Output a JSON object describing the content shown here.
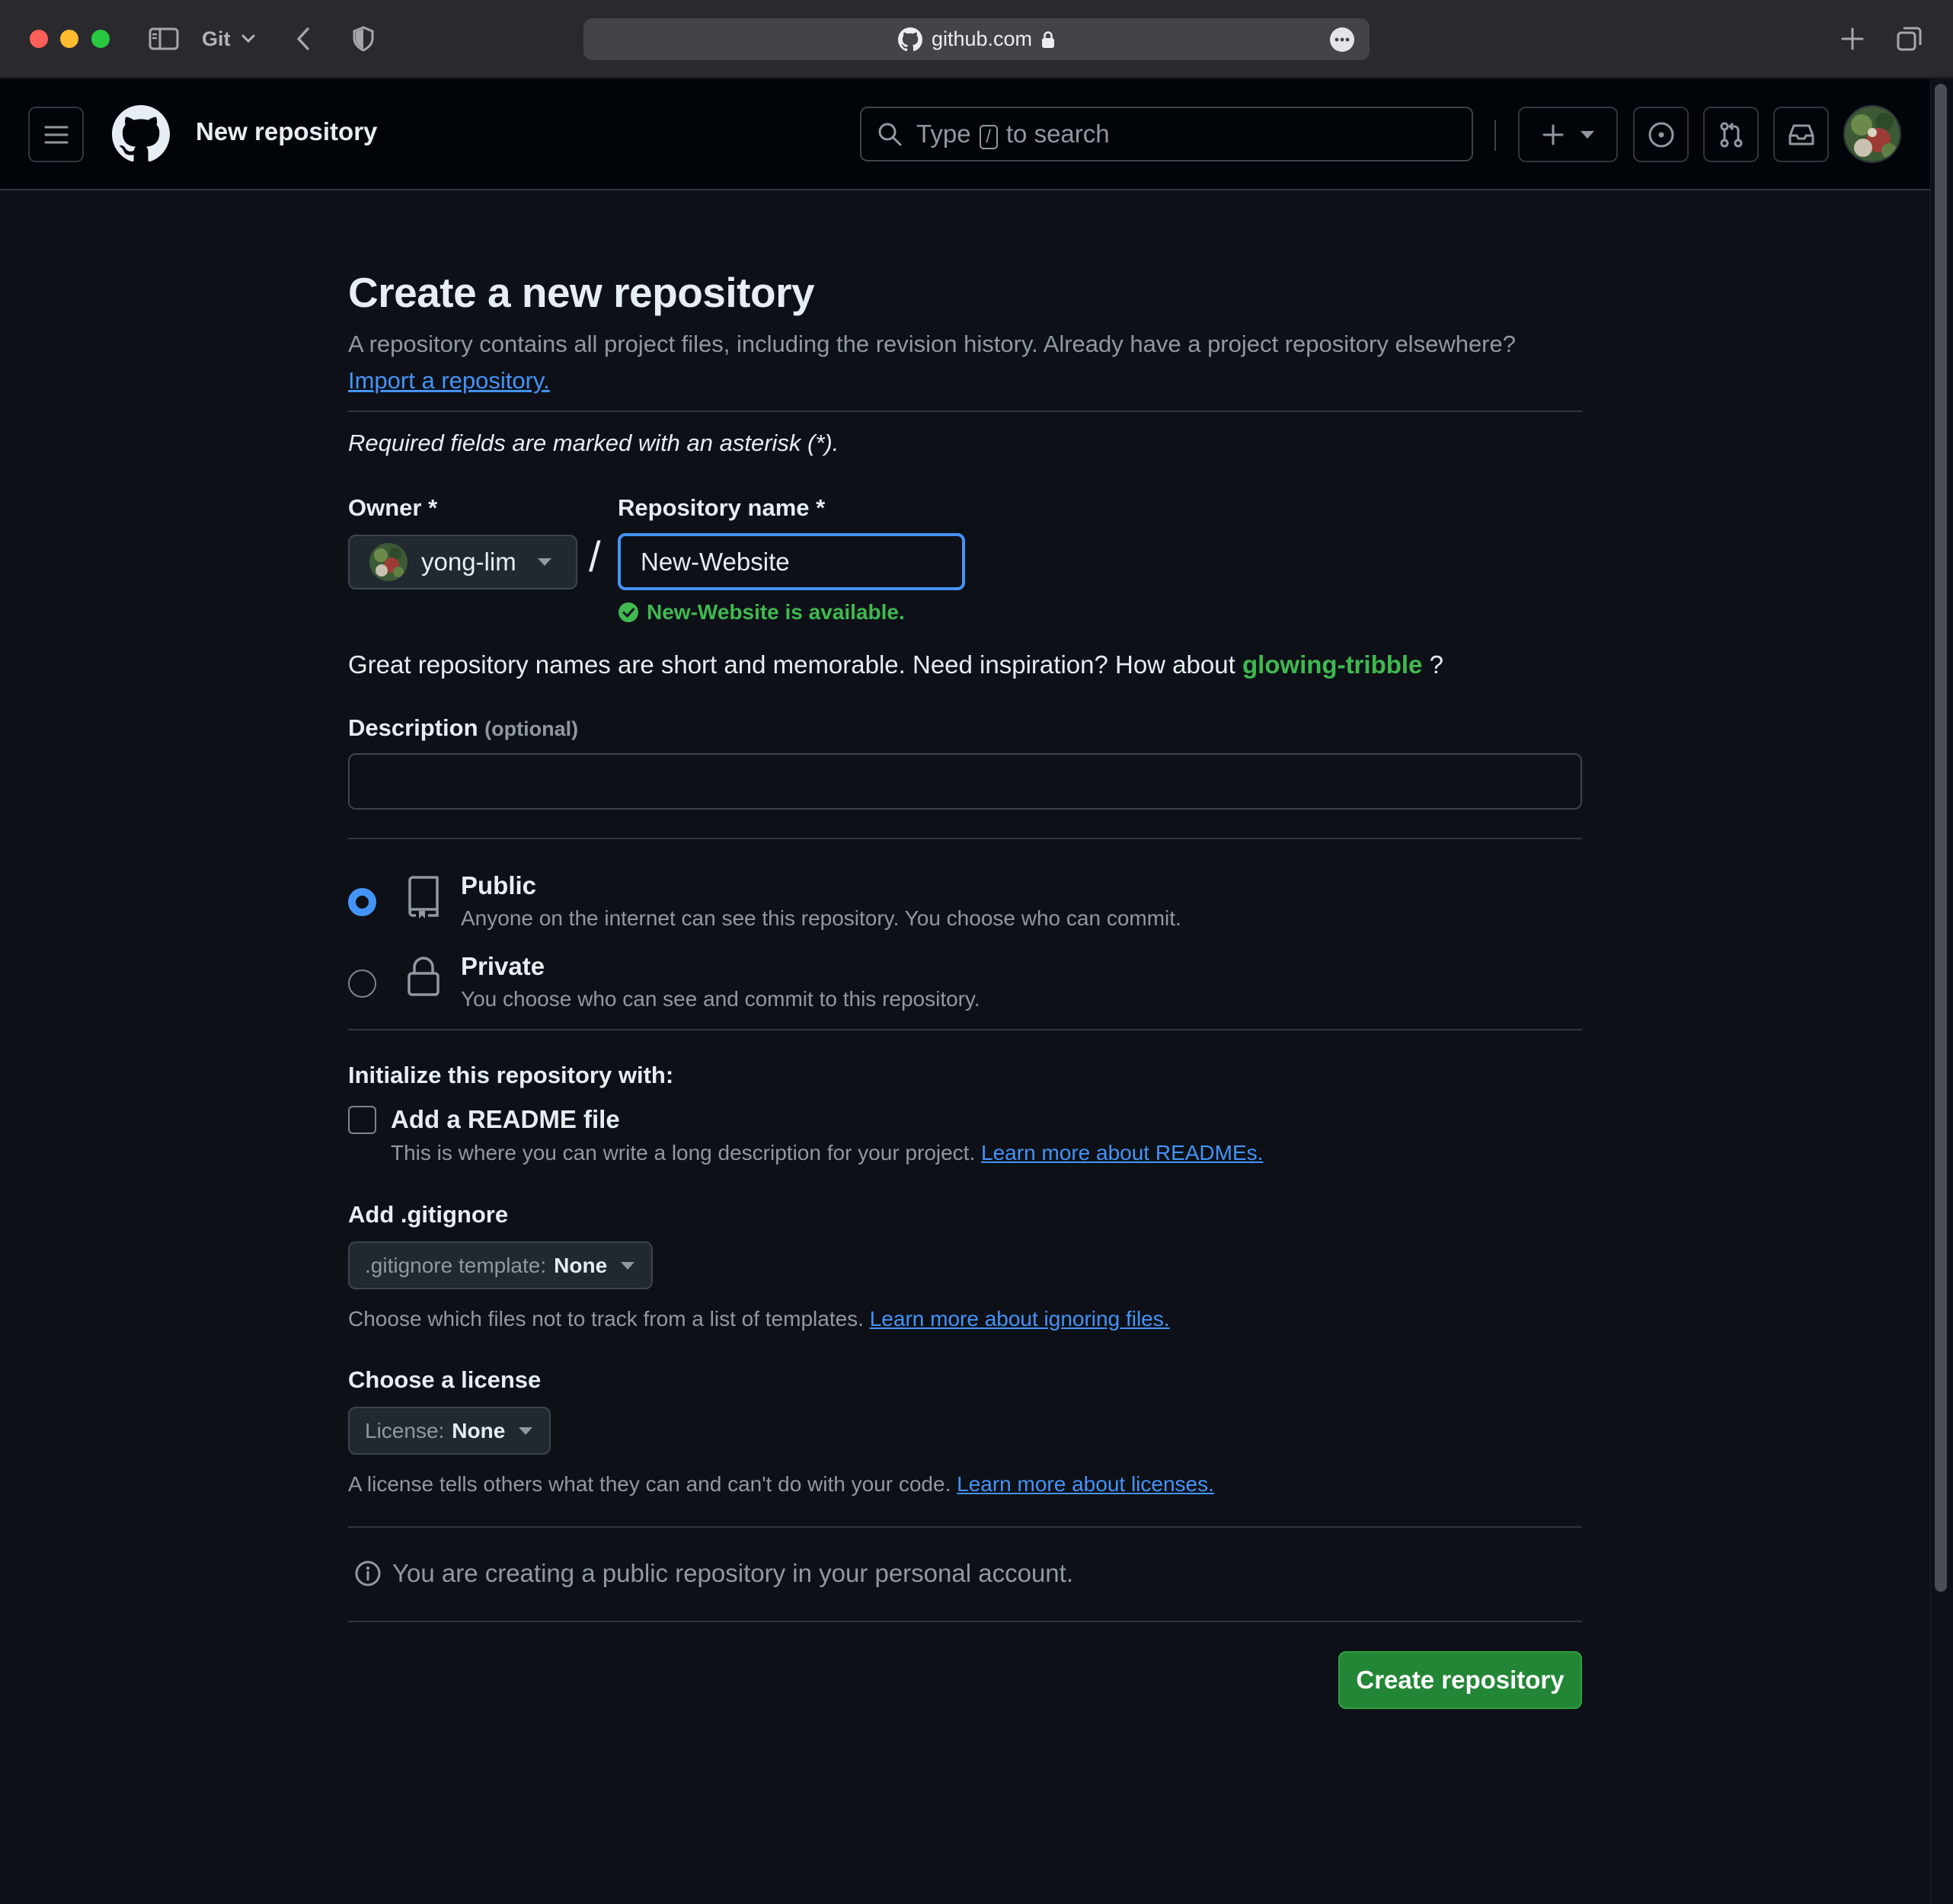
{
  "browser": {
    "tab_group": "Git",
    "url": "github.com",
    "icons": [
      "sidebar-icon",
      "back-icon",
      "shield-icon",
      "new-tab-icon",
      "tab-overview-icon"
    ]
  },
  "header": {
    "page_title": "New repository",
    "search": {
      "prefix": "Type",
      "key": "/",
      "suffix": "to search"
    },
    "icons": [
      "hamburger-icon",
      "github-logo",
      "plus-icon",
      "issues-icon",
      "pull-requests-icon",
      "inbox-icon"
    ]
  },
  "form": {
    "title": "Create a new repository",
    "intro": "A repository contains all project files, including the revision history. Already have a project repository elsewhere?",
    "import_link": "Import a repository.",
    "required_note": "Required fields are marked with an asterisk (*).",
    "owner_label": "Owner *",
    "owner_value": "yong-lim",
    "separator": "/",
    "repo_name_label": "Repository name *",
    "repo_name_value": "New-Website",
    "availability": "New-Website is available.",
    "suggestion_prefix": "Great repository names are short and memorable. Need inspiration? How about",
    "suggestion_name": "glowing-tribble",
    "suggestion_suffix": "?",
    "description_label": "Description",
    "description_optional": "(optional)",
    "description_value": "",
    "visibility": {
      "selected": "Public",
      "public_title": "Public",
      "public_desc": "Anyone on the internet can see this repository. You choose who can commit.",
      "private_title": "Private",
      "private_desc": "You choose who can see and commit to this repository."
    },
    "init_heading": "Initialize this repository with:",
    "readme_label": "Add a README file",
    "readme_checked": false,
    "readme_desc": "This is where you can write a long description for your project.",
    "readme_link": "Learn more about READMEs.",
    "gitignore_heading": "Add .gitignore",
    "gitignore_select_label": ".gitignore template:",
    "gitignore_select_value": "None",
    "gitignore_help": "Choose which files not to track from a list of templates.",
    "gitignore_link": "Learn more about ignoring files.",
    "license_heading": "Choose a license",
    "license_select_label": "License:",
    "license_select_value": "None",
    "license_help": "A license tells others what they can and can't do with your code.",
    "license_link": "Learn more about licenses.",
    "notice": "You are creating a public repository in your personal account.",
    "submit_label": "Create repository"
  },
  "colors": {
    "page_bg": "#0d1117",
    "header_bg": "#010409",
    "accent_blue": "#4493f8",
    "success_green": "#3fb950",
    "button_green": "#238636",
    "border": "#30363d",
    "muted_text": "#9198a1"
  }
}
